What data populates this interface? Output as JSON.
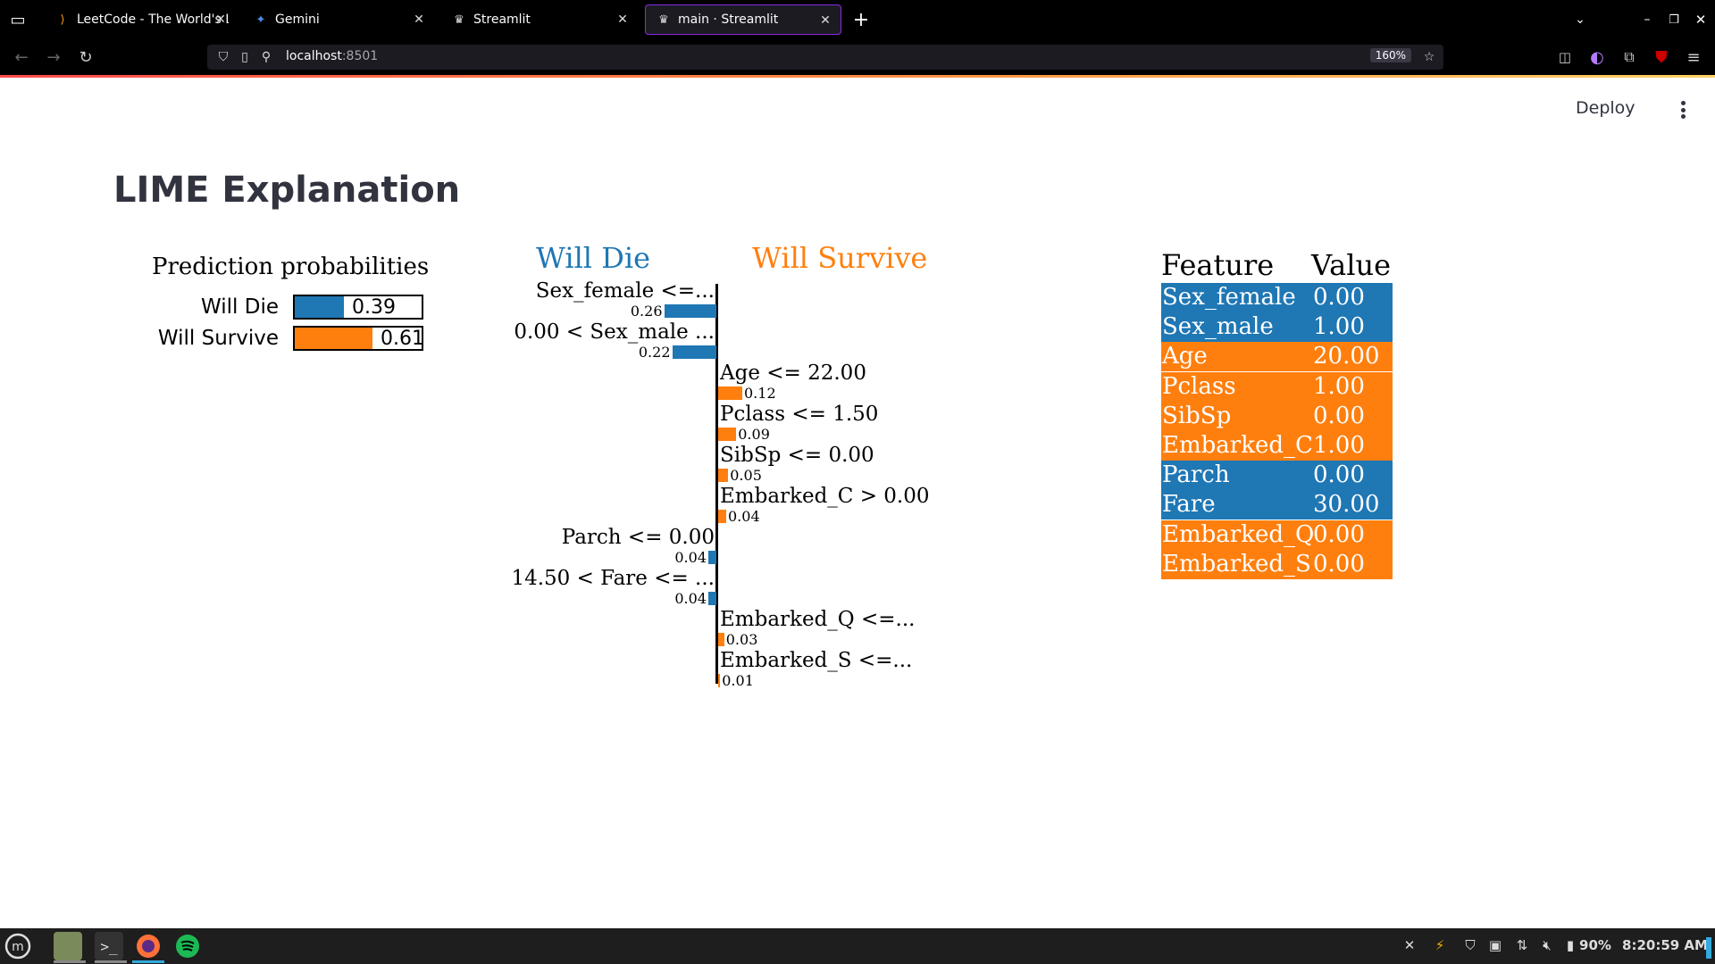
{
  "browser": {
    "tabs": [
      {
        "title": "LeetCode - The World's L",
        "icon": "leetcode-icon"
      },
      {
        "title": "Gemini",
        "icon": "gemini-icon"
      },
      {
        "title": "Streamlit",
        "icon": "streamlit-icon"
      },
      {
        "title": "main · Streamlit",
        "icon": "streamlit-icon",
        "active": true
      }
    ],
    "url_host": "localhost",
    "url_port": ":8501",
    "zoom": "160%"
  },
  "app": {
    "deploy_label": "Deploy",
    "page_title": "LIME Explanation"
  },
  "colors": {
    "will_die": "#1f77b4",
    "will_survive": "#ff7f0e"
  },
  "chart_data": [
    {
      "type": "bar",
      "title": "Prediction probabilities",
      "categories": [
        "Will Die",
        "Will Survive"
      ],
      "values": [
        0.39,
        0.61
      ],
      "value_labels": [
        "0.39",
        "0.61"
      ],
      "xlim": [
        0,
        1
      ]
    },
    {
      "type": "bar",
      "orientation": "horizontal",
      "class_labels": {
        "negative": "Will Die",
        "positive": "Will Survive"
      },
      "features": [
        {
          "label": "Sex_female <=...",
          "weight": -0.26,
          "weight_label": "0.26"
        },
        {
          "label": "0.00 < Sex_male ...",
          "weight": -0.22,
          "weight_label": "0.22"
        },
        {
          "label": "Age <= 22.00",
          "weight": 0.12,
          "weight_label": "0.12"
        },
        {
          "label": "Pclass <= 1.50",
          "weight": 0.09,
          "weight_label": "0.09"
        },
        {
          "label": "SibSp <= 0.00",
          "weight": 0.05,
          "weight_label": "0.05"
        },
        {
          "label": "Embarked_C > 0.00",
          "weight": 0.04,
          "weight_label": "0.04"
        },
        {
          "label": "Parch <= 0.00",
          "weight": -0.04,
          "weight_label": "0.04"
        },
        {
          "label": "14.50 < Fare <= ...",
          "weight": -0.04,
          "weight_label": "0.04"
        },
        {
          "label": "Embarked_Q <=...",
          "weight": 0.03,
          "weight_label": "0.03"
        },
        {
          "label": "Embarked_S <=...",
          "weight": 0.01,
          "weight_label": "0.01"
        }
      ]
    },
    {
      "type": "table",
      "columns": [
        "Feature",
        "Value"
      ],
      "rows": [
        {
          "feature": "Sex_female",
          "value": "0.00",
          "class": "will_die"
        },
        {
          "feature": "Sex_male",
          "value": "1.00",
          "class": "will_die"
        },
        {
          "feature": "Age",
          "value": "20.00",
          "class": "will_survive"
        },
        {
          "feature": "Pclass",
          "value": "1.00",
          "class": "will_survive"
        },
        {
          "feature": "SibSp",
          "value": "0.00",
          "class": "will_survive"
        },
        {
          "feature": "Embarked_C",
          "value": "1.00",
          "class": "will_survive"
        },
        {
          "feature": "Parch",
          "value": "0.00",
          "class": "will_die"
        },
        {
          "feature": "Fare",
          "value": "30.00",
          "class": "will_die"
        },
        {
          "feature": "Embarked_Q",
          "value": "0.00",
          "class": "will_survive"
        },
        {
          "feature": "Embarked_S",
          "value": "0.00",
          "class": "will_survive"
        }
      ]
    }
  ],
  "taskbar": {
    "apps": [
      "menu-icon",
      "files-icon",
      "terminal-icon",
      "firefox-icon",
      "spotify-icon"
    ],
    "battery": "90%",
    "clock": "8:20:59 AM"
  }
}
